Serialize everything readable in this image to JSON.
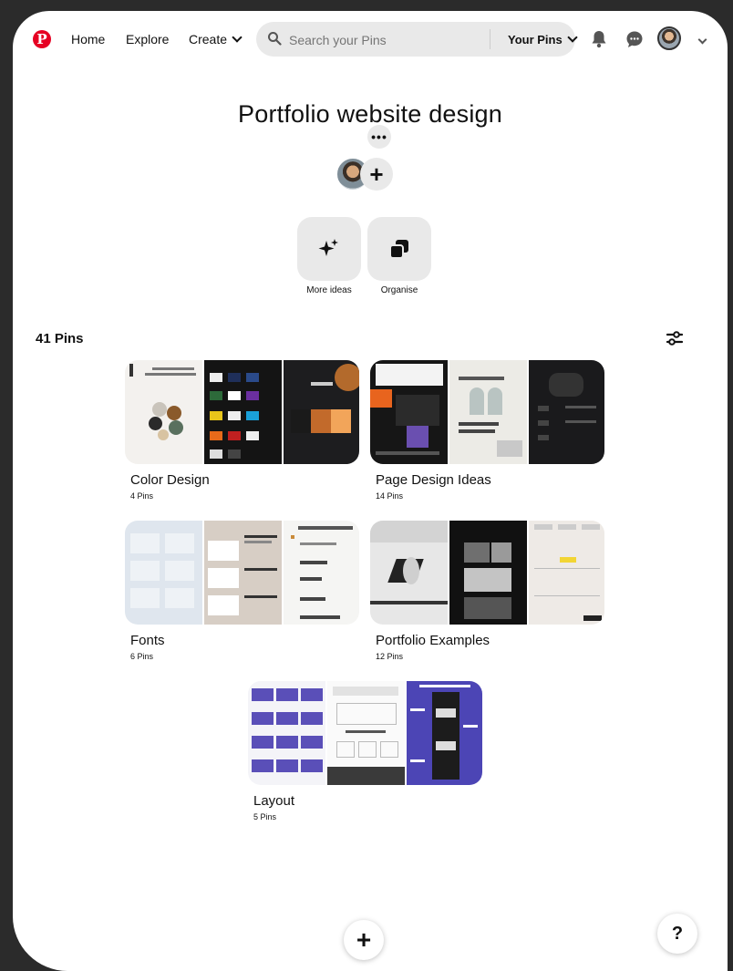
{
  "header": {
    "logo": "P",
    "nav": {
      "home": "Home",
      "explore": "Explore",
      "create": "Create"
    },
    "search": {
      "placeholder": "Search your Pins",
      "scope": "Your Pins"
    },
    "icons": [
      "pinterest-logo-icon",
      "search-icon",
      "bell-icon",
      "chat-icon",
      "avatar",
      "chevron-down-icon"
    ]
  },
  "board": {
    "title": "Portfolio website design",
    "more_label": "•••",
    "add_collaborator": "+",
    "tools": [
      {
        "label": "More ideas",
        "icon": "sparkle-icon"
      },
      {
        "label": "Organise",
        "icon": "organise-icon"
      }
    ]
  },
  "pins_count": "41 Pins",
  "sections": [
    {
      "name": "Color Design",
      "count": "4 Pins"
    },
    {
      "name": "Page Design Ideas",
      "count": "14 Pins"
    },
    {
      "name": "Fonts",
      "count": "6 Pins"
    },
    {
      "name": "Portfolio Examples",
      "count": "12 Pins"
    },
    {
      "name": "Layout",
      "count": "5 Pins"
    }
  ],
  "fab": {
    "create": "+",
    "help": "?"
  },
  "colors": {
    "brand": "#e60023",
    "surface": "#e9e9e9",
    "layout_accent": "#4c45b5"
  }
}
